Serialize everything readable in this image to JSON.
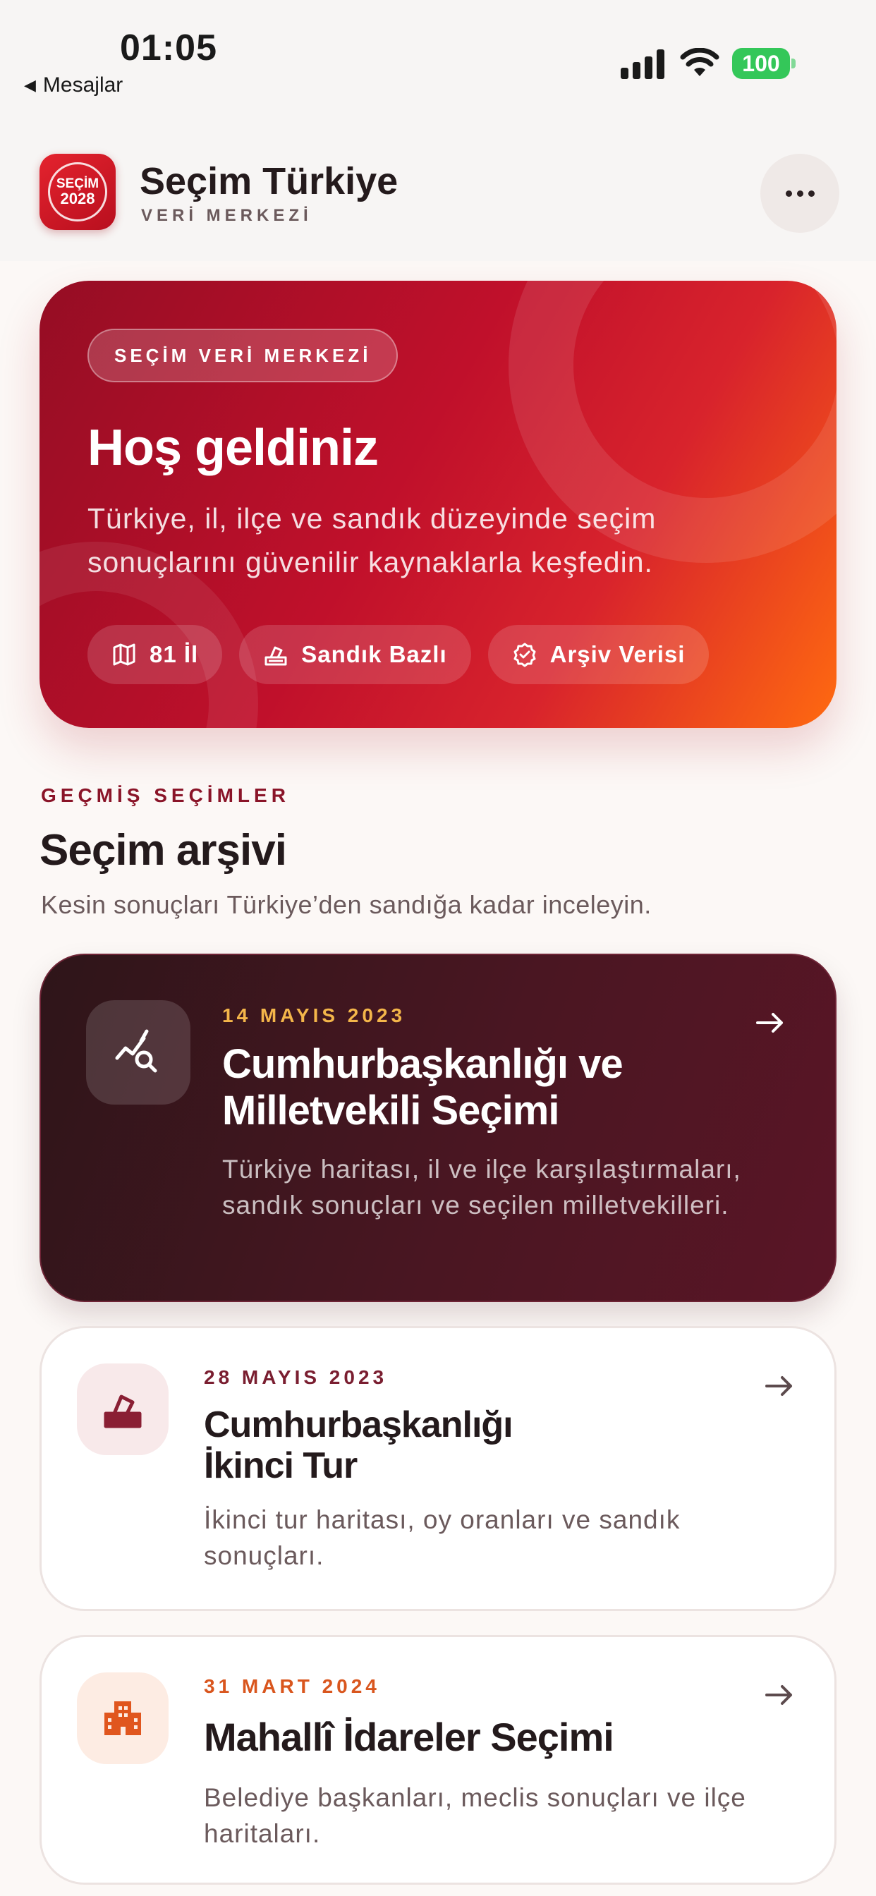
{
  "status_bar": {
    "time": "01:05",
    "back_label": "Mesajlar",
    "battery": "100",
    "battery_color": "#34c759"
  },
  "header": {
    "logo_line1": "SEÇİM",
    "logo_line2": "2028",
    "title": "Seçim Türkiye",
    "subtitle": "VERİ MERKEZİ",
    "more_icon": "ellipsis-icon"
  },
  "hero": {
    "badge": "SEÇİM VERİ MERKEZİ",
    "title": "Hoş geldiniz",
    "description": "Türkiye, il, ilçe ve sandık düzeyinde seçim sonuçlarını güvenilir kaynaklarla keşfedin.",
    "chips": [
      {
        "icon": "map-icon",
        "label": "81 İl"
      },
      {
        "icon": "ballot-box-icon",
        "label": "Sandık Bazlı"
      },
      {
        "icon": "verified-badge-icon",
        "label": "Arşiv Verisi"
      }
    ],
    "gradient": [
      "#950d24",
      "#c0102b",
      "#ff6a10"
    ]
  },
  "section": {
    "eyebrow": "GEÇMİŞ SEÇİMLER",
    "title": "Seçim arşivi",
    "description": "Kesin sonuçları Türkiye’den sandığa kadar inceleyin."
  },
  "elections": [
    {
      "date": "14 MAYIS 2023",
      "title": "Cumhurbaşkanlığı ve Milletvekili Seçimi",
      "description": "Türkiye haritası, il ve ilçe karşılaştırmaları, sandık sonuçları ve seçilen milletvekilleri.",
      "icon": "chart-search-icon",
      "accent": "#f4b64a"
    },
    {
      "date": "28 MAYIS 2023",
      "title_line1": "Cumhurbaşkanlığı",
      "title_line2": "İkinci Tur",
      "description": "İkinci tur haritası, oy oranları ve sandık sonuçları.",
      "icon": "ballot-box-icon",
      "accent": "#7a1e30"
    },
    {
      "date": "31 MART 2024",
      "title": "Mahallî İdareler Seçimi",
      "description": "Belediye başkanları, meclis sonuçları ve ilçe haritaları.",
      "icon": "city-buildings-icon",
      "accent": "#d9561e"
    }
  ]
}
